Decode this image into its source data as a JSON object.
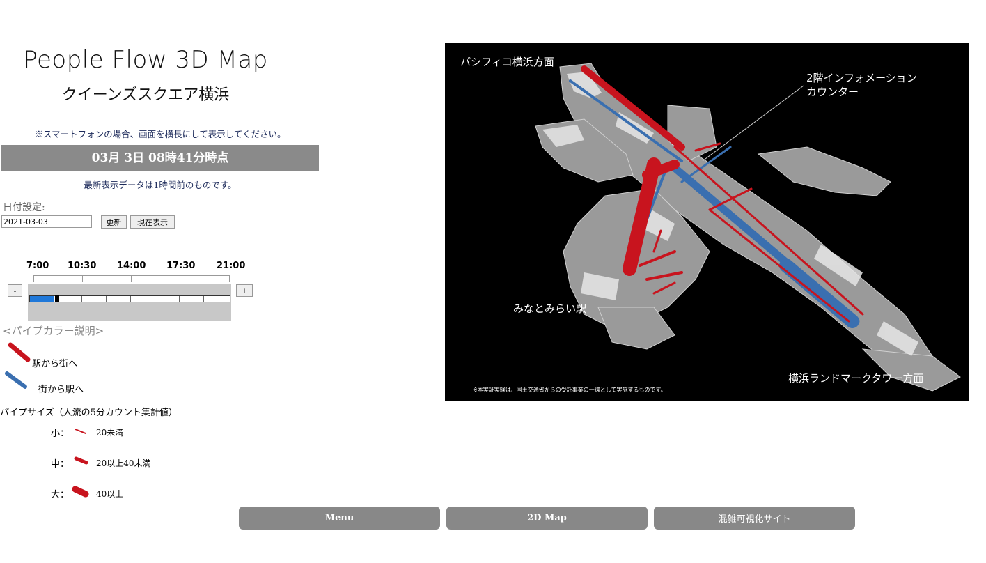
{
  "header": {
    "title": "People Flow 3D Map",
    "subtitle": "クイーンズスクエア横浜"
  },
  "notice": "※スマートフォンの場合、画面を横長にして表示してください。",
  "current_time": "03月 3日 08時41分時点",
  "latest_note": "最新表示データは1時間前のものです。",
  "date_setting": {
    "label": "日付設定:",
    "value": "2021-03-03",
    "update_label": "更新",
    "now_label": "現在表示"
  },
  "timeline": {
    "ticks": [
      "7:00",
      "10:30",
      "14:00",
      "17:30",
      "21:00"
    ],
    "minus_label": "-",
    "plus_label": "+",
    "position_fraction": 0.12
  },
  "legend": {
    "title": "<パイプカラー説明>",
    "red_label": "駅から街へ",
    "blue_label": "街から駅へ",
    "red_color": "#c8141e",
    "blue_color": "#3a6fb0"
  },
  "pipe_size": {
    "title": "パイプサイズ（人流の5分カウント集計値）",
    "small": {
      "label": "小：",
      "text": "20未満"
    },
    "medium": {
      "label": "中：",
      "text": "20以上40未満"
    },
    "large": {
      "label": "大：",
      "text": "40以上"
    }
  },
  "map": {
    "label_top_left": "パシフィコ横浜方面",
    "label_info_line1": "2階インフォメーション",
    "label_info_line2": "カウンター",
    "label_station": "みなとみらい駅",
    "label_bottom_right": "横浜ランドマークタワー方面",
    "footnote": "※本実証実験は、国土交通省からの受託事業の一環として実施するものです。"
  },
  "nav": {
    "menu_label": "Menu",
    "map2d_label": "2D Map",
    "congestion_label": "混雑可視化サイト"
  }
}
